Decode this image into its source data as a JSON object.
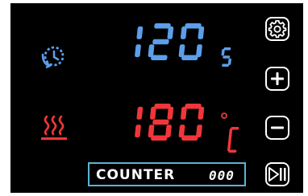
{
  "colors": {
    "panel_bg": "#000000",
    "timer_blue": "#5b9fea",
    "temp_red": "#f0363a",
    "white": "#ffffff",
    "counter_border": "#5bb4d4"
  },
  "timer": {
    "value": "120",
    "unit": "s",
    "icon": "timer-clock-icon"
  },
  "temperature": {
    "value": "180",
    "unit": "°C",
    "icon": "heating-waves-icon"
  },
  "counter": {
    "label": "COUNTER",
    "value": "000"
  },
  "buttons": {
    "settings": "gear-icon",
    "increase": "plus-icon",
    "decrease": "minus-icon",
    "start_pause": "play-pause-icon"
  }
}
